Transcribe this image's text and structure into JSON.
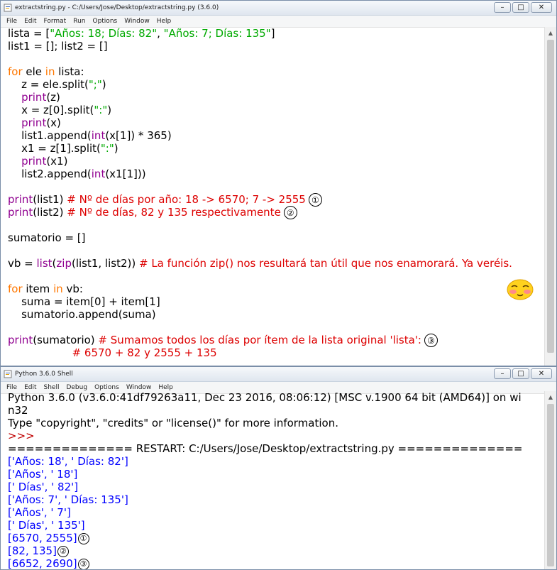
{
  "editor": {
    "title": "extractstring.py - C:/Users/Jose/Desktop/extractstring.py (3.6.0)",
    "menu": [
      "File",
      "Edit",
      "Format",
      "Run",
      "Options",
      "Window",
      "Help"
    ],
    "lines": [
      [
        {
          "t": "lista = [",
          "c": ""
        },
        {
          "t": "\"Años: 18; Días: 82\"",
          "c": "st"
        },
        {
          "t": ", ",
          "c": ""
        },
        {
          "t": "\"Años: 7; Días: 135\"",
          "c": "st"
        },
        {
          "t": "]",
          "c": ""
        }
      ],
      [
        {
          "t": "list1 = []; list2 = []",
          "c": ""
        }
      ],
      [],
      [
        {
          "t": "for",
          "c": "kw"
        },
        {
          "t": " ele ",
          "c": ""
        },
        {
          "t": "in",
          "c": "kw"
        },
        {
          "t": " lista:",
          "c": ""
        }
      ],
      [
        {
          "t": "    z = ele.split(",
          "c": ""
        },
        {
          "t": "\";\"",
          "c": "st"
        },
        {
          "t": ")",
          "c": ""
        }
      ],
      [
        {
          "t": "    ",
          "c": ""
        },
        {
          "t": "print",
          "c": "bi"
        },
        {
          "t": "(z)",
          "c": ""
        }
      ],
      [
        {
          "t": "    x = z[0].split(",
          "c": ""
        },
        {
          "t": "\":\"",
          "c": "st"
        },
        {
          "t": ")",
          "c": ""
        }
      ],
      [
        {
          "t": "    ",
          "c": ""
        },
        {
          "t": "print",
          "c": "bi"
        },
        {
          "t": "(x)",
          "c": ""
        }
      ],
      [
        {
          "t": "    list1.append(",
          "c": ""
        },
        {
          "t": "int",
          "c": "bi"
        },
        {
          "t": "(x[1]) * 365)",
          "c": ""
        }
      ],
      [
        {
          "t": "    x1 = z[1].split(",
          "c": ""
        },
        {
          "t": "\":\"",
          "c": "st"
        },
        {
          "t": ")",
          "c": ""
        }
      ],
      [
        {
          "t": "    ",
          "c": ""
        },
        {
          "t": "print",
          "c": "bi"
        },
        {
          "t": "(x1)",
          "c": ""
        }
      ],
      [
        {
          "t": "    list2.append(",
          "c": ""
        },
        {
          "t": "int",
          "c": "bi"
        },
        {
          "t": "(x1[1]))",
          "c": ""
        }
      ],
      [],
      [
        {
          "t": "print",
          "c": "bi"
        },
        {
          "t": "(list1) ",
          "c": ""
        },
        {
          "t": "# Nº de días por año: 18 -> 6570; 7 -> 2555",
          "c": "cm"
        },
        {
          "t": "①",
          "c": "circ"
        }
      ],
      [
        {
          "t": "print",
          "c": "bi"
        },
        {
          "t": "(list2) ",
          "c": ""
        },
        {
          "t": "# Nº de días, 82 y 135 respectivamente",
          "c": "cm"
        },
        {
          "t": "②",
          "c": "circ"
        }
      ],
      [],
      [
        {
          "t": "sumatorio = []",
          "c": ""
        }
      ],
      [],
      [
        {
          "t": "vb = ",
          "c": ""
        },
        {
          "t": "list",
          "c": "bi"
        },
        {
          "t": "(",
          "c": ""
        },
        {
          "t": "zip",
          "c": "bi"
        },
        {
          "t": "(list1, list2)) ",
          "c": ""
        },
        {
          "t": "# La función zip() nos resultará tan útil que nos enamorará. Ya veréis.",
          "c": "cm"
        }
      ],
      [],
      [
        {
          "t": "for",
          "c": "kw"
        },
        {
          "t": " item ",
          "c": ""
        },
        {
          "t": "in",
          "c": "kw"
        },
        {
          "t": " vb:",
          "c": ""
        }
      ],
      [
        {
          "t": "    suma = item[0] + item[1]",
          "c": ""
        }
      ],
      [
        {
          "t": "    sumatorio.append(suma)",
          "c": ""
        }
      ],
      [],
      [
        {
          "t": "print",
          "c": "bi"
        },
        {
          "t": "(sumatorio) ",
          "c": ""
        },
        {
          "t": "# Sumamos todos los días por ítem de la lista original 'lista':",
          "c": "cm"
        },
        {
          "t": "③",
          "c": "circ"
        }
      ],
      [
        {
          "t": "                   ",
          "c": ""
        },
        {
          "t": "# 6570 + 82 y 2555 + 135",
          "c": "cm"
        }
      ]
    ]
  },
  "shell": {
    "title": "Python 3.6.0 Shell",
    "menu": [
      "File",
      "Edit",
      "Shell",
      "Debug",
      "Options",
      "Window",
      "Help"
    ],
    "lines": [
      [
        {
          "t": "Python 3.6.0 (v3.6.0:41df79263a11, Dec 23 2016, 08:06:12) [MSC v.1900 64 bit (AMD64)] on wi",
          "c": ""
        }
      ],
      [
        {
          "t": "n32",
          "c": ""
        }
      ],
      [
        {
          "t": "Type \"copyright\", \"credits\" or \"license()\" for more information.",
          "c": ""
        }
      ],
      [
        {
          "t": ">>> ",
          "c": "prompt"
        }
      ],
      [
        {
          "t": "============== RESTART: C:/Users/Jose/Desktop/extractstring.py ==============",
          "c": ""
        }
      ],
      [
        {
          "t": "['Años: 18', ' Días: 82']",
          "c": "out"
        }
      ],
      [
        {
          "t": "['Años', ' 18']",
          "c": "out"
        }
      ],
      [
        {
          "t": "[' Días', ' 82']",
          "c": "out"
        }
      ],
      [
        {
          "t": "['Años: 7', ' Días: 135']",
          "c": "out"
        }
      ],
      [
        {
          "t": "['Años', ' 7']",
          "c": "out"
        }
      ],
      [
        {
          "t": "[' Días', ' 135']",
          "c": "out"
        }
      ],
      [
        {
          "t": "[6570, 2555]",
          "c": "out"
        },
        {
          "t": "①",
          "c": "circ sm"
        }
      ],
      [
        {
          "t": "[82, 135]",
          "c": "out"
        },
        {
          "t": "②",
          "c": "circ sm"
        }
      ],
      [
        {
          "t": "[6652, 2690]",
          "c": "out"
        },
        {
          "t": "③",
          "c": "circ sm"
        }
      ]
    ]
  },
  "window_buttons": {
    "minimize": "–",
    "maximize": "□",
    "close": "✕"
  },
  "colors": {
    "keyword": "#ff7700",
    "builtin": "#900090",
    "string": "#00aa00",
    "comment": "#dd0000",
    "output": "#0000ff"
  },
  "icons": {
    "app": "python-idle-icon",
    "emoji": "blushing-face-emoji"
  }
}
